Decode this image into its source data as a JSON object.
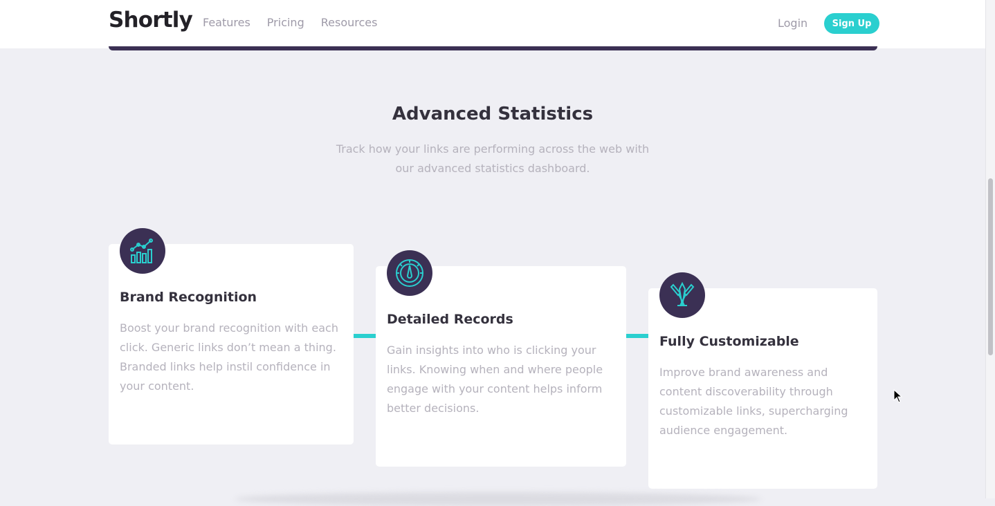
{
  "header": {
    "logo": "Shortly",
    "nav": [
      "Features",
      "Pricing",
      "Resources"
    ],
    "login": "Login",
    "signup": "Sign Up"
  },
  "section": {
    "title": "Advanced Statistics",
    "subtitle": "Track how your links are performing across the web with our advanced statistics dashboard."
  },
  "cards": [
    {
      "icon": "brand-recognition-icon",
      "title": "Brand Recognition",
      "text": "Boost your brand recognition with each click. Generic links don’t mean a thing. Branded links help instil confidence in your content."
    },
    {
      "icon": "detailed-records-icon",
      "title": "Detailed Records",
      "text": "Gain insights into who is clicking your links. Knowing when and where people engage with your content helps inform better decisions."
    },
    {
      "icon": "fully-customizable-icon",
      "title": "Fully Customizable",
      "text": "Improve brand awareness and content discoverability through customizable links, supercharging audience engagement."
    }
  ],
  "colors": {
    "primary": "#2acfcf",
    "dark_violet": "#3b3054",
    "background": "#efeff4",
    "grayish_violet": "#9e9aa8"
  }
}
